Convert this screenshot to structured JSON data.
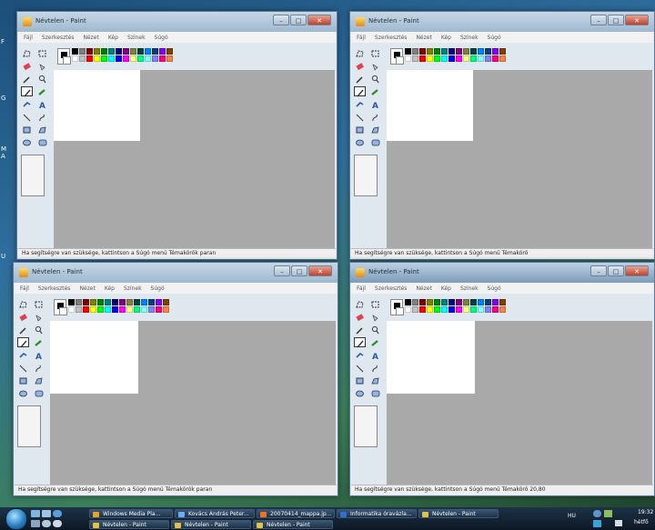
{
  "desktop": {
    "left_labels": [
      "M",
      "A",
      "G",
      "F",
      "U"
    ]
  },
  "paint": {
    "title": "Névtelen - Paint",
    "menu": [
      "Fájl",
      "Szerkesztés",
      "Nézet",
      "Kép",
      "Színek",
      "Súgó"
    ],
    "window_controls": {
      "minimize": "–",
      "maximize": "□",
      "close": "✕"
    },
    "palette_colors": [
      "#000000",
      "#808080",
      "#800000",
      "#808000",
      "#008000",
      "#008080",
      "#000080",
      "#800080",
      "#808040",
      "#004040",
      "#0080ff",
      "#004080",
      "#8000ff",
      "#804000",
      "#ffffff",
      "#c0c0c0",
      "#ff0000",
      "#ffff00",
      "#00ff00",
      "#00ffff",
      "#0000ff",
      "#ff00ff",
      "#ffff80",
      "#00ff80",
      "#80ffff",
      "#8080ff",
      "#ff0080",
      "#ff8040"
    ],
    "tools": [
      "free-select",
      "rect-select",
      "eraser",
      "fill",
      "picker",
      "magnifier",
      "pencil",
      "brush",
      "airbrush",
      "text",
      "line",
      "curve",
      "rectangle",
      "polygon",
      "ellipse",
      "rounded-rect"
    ]
  },
  "windows": [
    {
      "id": "top-left",
      "status": "Ha segítségre van szüksége, kattintson a Súgó menü Témakörök paran",
      "active": false
    },
    {
      "id": "top-right",
      "status": "Ha segítségre van szüksége, kattintson a Súgó menü Témakörö",
      "active": false
    },
    {
      "id": "bottom-left",
      "status": "Ha segítségre van szüksége, kattintson a Súgó menü Témakörök paran",
      "active": false
    },
    {
      "id": "bottom-right",
      "status": "Ha segítségre van szüksége, kattintson a Súgó menü Témakörö 20,80",
      "active": true
    }
  ],
  "taskbar": {
    "row1": [
      "Windows Media Pla...",
      "Kovács András Peter...",
      "20070414_mappa.jp...",
      "Informatika óravázla...",
      "Névtelen - Paint"
    ],
    "row2": [
      "Névtelen - Paint",
      "Névtelen - Paint",
      "Névtelen - Paint"
    ],
    "language": "HU",
    "clock": "19:32",
    "day": "hétfő"
  }
}
